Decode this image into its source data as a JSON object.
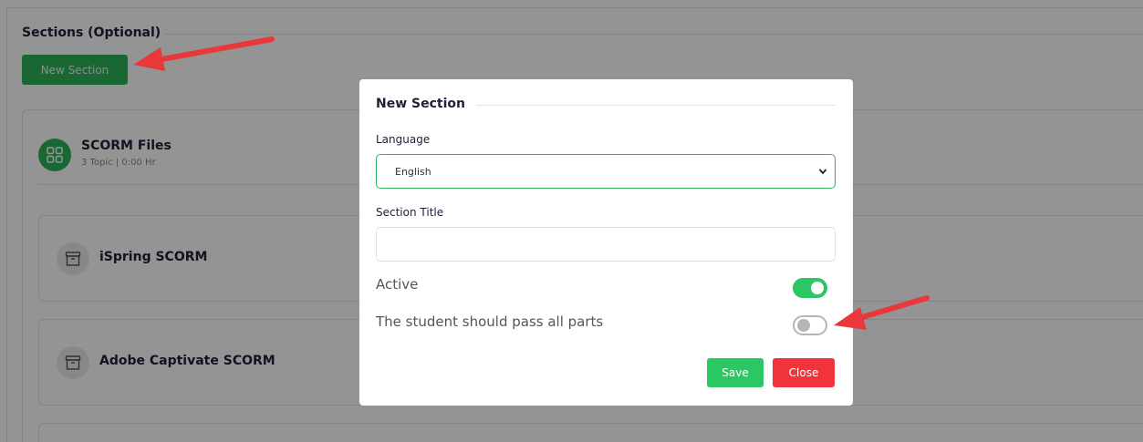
{
  "page": {
    "sections_heading": "Sections (Optional)",
    "new_section_button": "New Section",
    "course_card": {
      "title": "SCORM Files",
      "subtitle": "3 Topic | 0:00 Hr"
    },
    "topics": [
      {
        "title": "iSpring SCORM"
      },
      {
        "title": "Adobe Captivate SCORM"
      }
    ]
  },
  "modal": {
    "title": "New Section",
    "language_label": "Language",
    "language_value": "English",
    "section_title_label": "Section Title",
    "section_title_value": "",
    "active_label": "Active",
    "active_on": true,
    "pass_all_label": "The student should pass all parts",
    "pass_all_on": false,
    "save_label": "Save",
    "close_label": "Close"
  },
  "colors": {
    "accent_green": "#2bb35a",
    "toggle_green": "#2bc764",
    "danger_red": "#f0343b",
    "annotation_arrow": "#e8383b"
  },
  "icons": {
    "course": "grid-icon",
    "topic": "archive-icon",
    "select": "chevron-down-icon"
  }
}
